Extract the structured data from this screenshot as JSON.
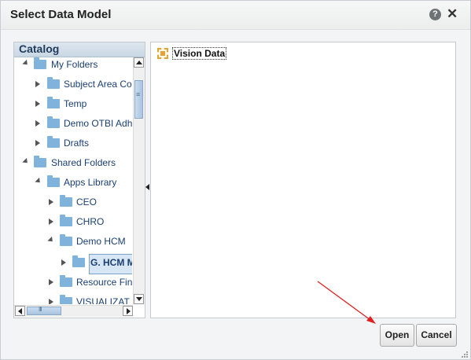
{
  "dialog": {
    "title": "Select Data Model",
    "help_icon": "help-icon",
    "help_glyph": "?",
    "close_icon": "close-icon",
    "close_glyph": "✕"
  },
  "catalog": {
    "title": "Catalog",
    "items": [
      {
        "label": "My Folders",
        "state": "expanded"
      },
      {
        "label": "Subject Area Co",
        "state": "collapsed"
      },
      {
        "label": "Temp",
        "state": "collapsed"
      },
      {
        "label": "Demo OTBI Adh",
        "state": "collapsed"
      },
      {
        "label": "Drafts",
        "state": "collapsed"
      },
      {
        "label": "Shared Folders",
        "state": "expanded"
      },
      {
        "label": "Apps Library",
        "state": "expanded"
      },
      {
        "label": "CEO",
        "state": "collapsed"
      },
      {
        "label": "CHRO",
        "state": "collapsed"
      },
      {
        "label": "Demo HCM",
        "state": "expanded"
      },
      {
        "label": "G. HCM M",
        "state": "collapsed",
        "selected": true
      },
      {
        "label": "Resource Fin",
        "state": "collapsed"
      },
      {
        "label": "VISUALIZAT",
        "state": "collapsed"
      }
    ],
    "vscroll_grip": "≡",
    "hscroll_grip": "III"
  },
  "content": {
    "items": [
      {
        "label": "Vision Data",
        "icon": "data-model-icon"
      }
    ]
  },
  "buttons": {
    "open": "Open",
    "cancel": "Cancel"
  },
  "colors": {
    "folder": "#7fb3dc",
    "tree_text": "#1a3f73",
    "annotation_arrow": "#e02020",
    "data_model_icon": "#e2a43a"
  }
}
